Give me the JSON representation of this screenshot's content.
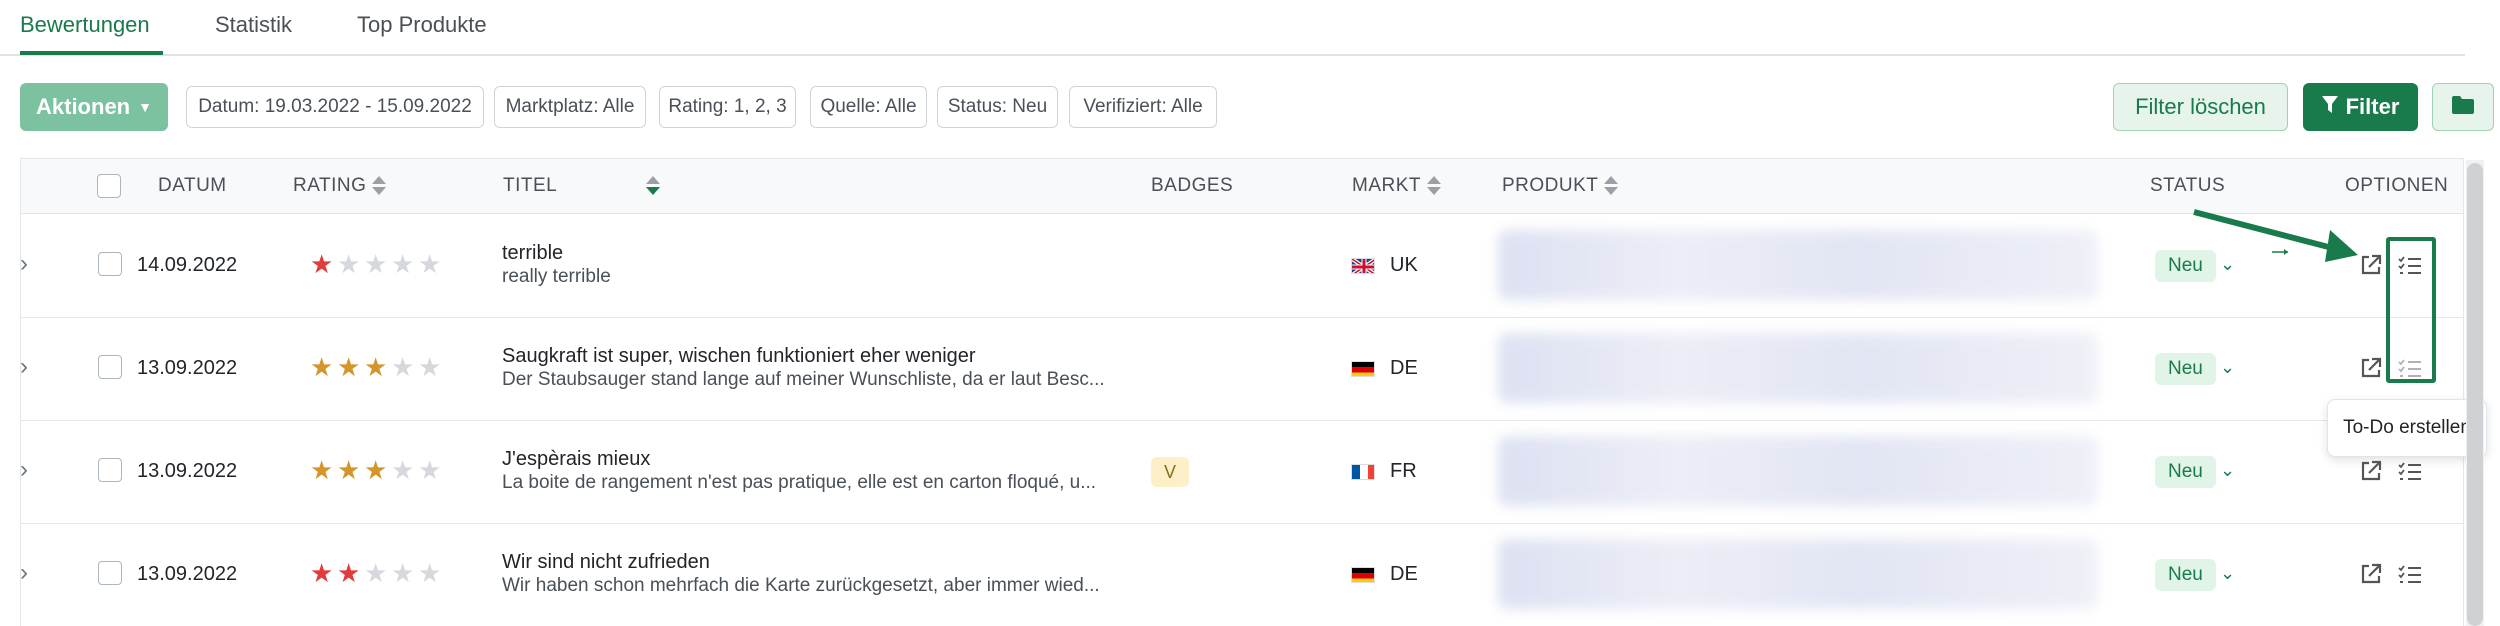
{
  "tabs": [
    {
      "label": "Bewertungen",
      "active": true
    },
    {
      "label": "Statistik",
      "active": false
    },
    {
      "label": "Top Produkte",
      "active": false
    }
  ],
  "toolbar": {
    "actions_label": "Aktionen",
    "filter_chips": [
      "Datum: 19.03.2022 - 15.09.2022",
      "Marktplatz: Alle",
      "Rating: 1, 2, 3",
      "Quelle: Alle",
      "Status: Neu",
      "Verifiziert: Alle"
    ],
    "clear_filter_label": "Filter löschen",
    "filter_label": "Filter"
  },
  "table": {
    "columns": {
      "date": "DATUM",
      "rating": "RATING",
      "title": "TITEL",
      "badges": "BADGES",
      "market": "MARKT",
      "product": "PRODUKT",
      "status": "STATUS",
      "options": "OPTIONEN"
    },
    "rows": [
      {
        "date": "14.09.2022",
        "rating": 1,
        "star_color": "#e23b3b",
        "title": "terrible",
        "description": "really terrible",
        "badge": "",
        "flag": "uk",
        "market": "UK",
        "status": "Neu"
      },
      {
        "date": "13.09.2022",
        "rating": 3,
        "star_color": "#d4962a",
        "title": "Saugkraft ist super, wischen funktioniert eher weniger",
        "description": "Der Staubsauger stand lange auf meiner Wunschliste, da er laut Besc...",
        "badge": "",
        "flag": "de",
        "market": "DE",
        "status": "Neu"
      },
      {
        "date": "13.09.2022",
        "rating": 3,
        "star_color": "#d4962a",
        "title": "J'espèrais mieux",
        "description": "La boite de rangement n'est pas pratique, elle est en carton floqué, u...",
        "badge": "V",
        "flag": "fr",
        "market": "FR",
        "status": "Neu"
      },
      {
        "date": "13.09.2022",
        "rating": 2,
        "star_color": "#e23b3b",
        "title": "Wir sind nicht zufrieden",
        "description": "Wir haben schon mehrfach die Karte zurückgesetzt, aber immer wied...",
        "badge": "",
        "flag": "de",
        "market": "DE",
        "status": "Neu"
      }
    ]
  },
  "tooltip": "To-Do erstellen",
  "colors": {
    "primary": "#197a4b",
    "status_bg": "#e1f4e8",
    "badge_bg": "#fdf0c8"
  }
}
